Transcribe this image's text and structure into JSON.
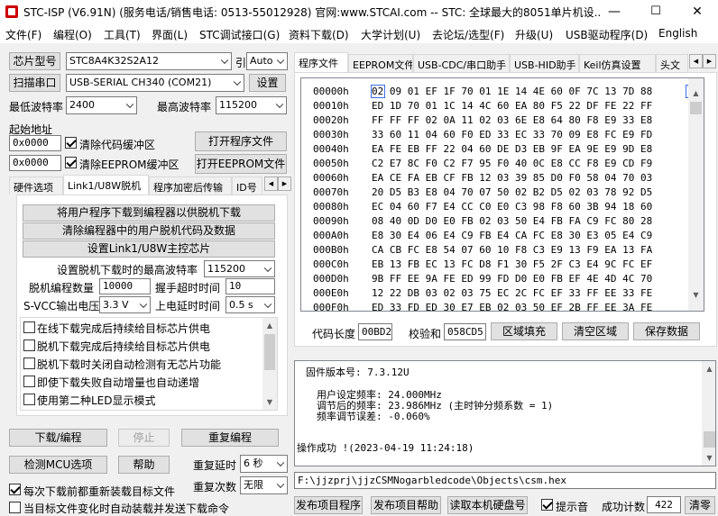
{
  "window": {
    "title": "STC-ISP (V6.91N) (服务电话/销售电话: 0513-55012928) 官网:www.STCAI.com  -- STC: 全球最大的8051单片机设...",
    "minimize": "—",
    "maximize": "☐",
    "close": "✕"
  },
  "menu": [
    "文件(F)",
    "编程(O)",
    "工具(T)",
    "界面(L)",
    "STC调试接口(G)",
    "资料下载(D)",
    "大学计划(U)",
    "去论坛/选型(F)",
    "升级(U)",
    "USB驱动程序(D)",
    "English"
  ],
  "left": {
    "chip_type_label": "芯片型号",
    "chip_type_value": "STC8A4K32S2A12",
    "pin_count_label": "引脚数",
    "pin_count_value": "Auto",
    "scan_port_label": "扫描串口",
    "port_value": "USB-SERIAL CH340 (COM21)",
    "settings_label": "设置",
    "min_baud_label": "最低波特率",
    "min_baud_value": "2400",
    "max_baud_label": "最高波特率",
    "max_baud_value": "115200",
    "start_addr_label": "起始地址",
    "addr1_value": "0x0000",
    "clear_code_label": "清除代码缓冲区",
    "open_program_label": "打开程序文件",
    "addr2_value": "0x0000",
    "clear_eeprom_label": "清除EEPROM缓冲区",
    "open_eeprom_label": "打开EEPROM文件",
    "tabs": [
      "硬件选项",
      "Link1/U8W脱机",
      "程序加密后传输",
      "ID号"
    ],
    "offline": {
      "btn1": "将用户程序下载到编程器以供脱机下载",
      "btn2": "清除编程器中的用户脱机代码及数据",
      "btn3": "设置Link1/U8W主控芯片",
      "max_baud_label": "设置脱机下载时的最高波特率",
      "max_baud_value": "115200",
      "count_label": "脱机编程数量",
      "count_value": "10000",
      "hand_delay_label": "握手超时时间",
      "hand_delay_value": "10",
      "vcc_label": "S-VCC输出电压",
      "vcc_value": "3.3 V",
      "power_delay_label": "上电延时时间",
      "power_delay_value": "0.5 s",
      "options": [
        "在线下载完成后持续给目标芯片供电",
        "脱机下载完成后持续给目标芯片供电",
        "脱机下载时关闭自动检测有无芯片功能",
        "即使下载失败自动增量也自动递增",
        "使用第二种LED显示模式"
      ]
    },
    "download_label": "下载/编程",
    "stop_label": "停止",
    "reprogram_label": "重复编程",
    "detect_mcu_label": "检测MCU选项",
    "help_label": "帮助",
    "repeat_delay_label": "重复延时",
    "repeat_delay_value": "6 秒",
    "reload_label": "每次下载前都重新装载目标文件",
    "repeat_count_label": "重复次数",
    "repeat_count_value": "无限",
    "auto_load_label": "当目标文件变化时自动装载并发送下载命令"
  },
  "right": {
    "tabs": [
      "程序文件",
      "EEPROM文件",
      "USB-CDC/串口助手",
      "USB-HID助手",
      "Keil仿真设置",
      "头文"
    ],
    "hex_rows": [
      {
        "addr": "00000h",
        "bytes": "02 09 01 EF 1F 70 01 1E 14 4E 60 0F 7C 13 7D 88"
      },
      {
        "addr": "00010h",
        "bytes": "ED 1D 70 01 1C 14 4C 60 EA 80 F5 22 DF FE 22 FF"
      },
      {
        "addr": "00020h",
        "bytes": "FF FF FF 02 0A 11 02 03 6E E8 64 80 F8 E9 33 E8"
      },
      {
        "addr": "00030h",
        "bytes": "33 60 11 04 60 F0 ED 33 EC 33 70 09 E8 FC E9 FD"
      },
      {
        "addr": "00040h",
        "bytes": "EA FE EB FF 22 04 60 DE D3 EB 9F EA 9E E9 9D E8"
      },
      {
        "addr": "00050h",
        "bytes": "C2 E7 8C F0 C2 F7 95 F0 40 0C E8 CC F8 E9 CD F9"
      },
      {
        "addr": "00060h",
        "bytes": "EA CE FA EB CF FB 12 03 39 85 D0 F0 58 04 70 03"
      },
      {
        "addr": "00070h",
        "bytes": "20 D5 B3 E8 04 70 07 50 02 B2 D5 02 03 78 92 D5"
      },
      {
        "addr": "00080h",
        "bytes": "EC 04 60 F7 E4 CC C0 E0 C3 98 F8 60 3B 94 18 60"
      },
      {
        "addr": "00090h",
        "bytes": "08 40 0D D0 E0 FB 02 03 50 E4 FB FA C9 FC 80 28"
      },
      {
        "addr": "000A0h",
        "bytes": "E8 30 E4 06 E4 C9 FB E4 CA FC E8 30 E3 05 E4 C9"
      },
      {
        "addr": "000B0h",
        "bytes": "CA CB FC E8 54 07 60 10 F8 C3 E9 13 F9 EA 13 FA"
      },
      {
        "addr": "000C0h",
        "bytes": "EB 13 FB EC 13 FC D8 F1 30 F5 2F C3 E4 9C FC EF"
      },
      {
        "addr": "000D0h",
        "bytes": "9B FF EE 9A FE ED 99 FD D0 E0 FB EF 4E 4D 4C 70"
      },
      {
        "addr": "000E0h",
        "bytes": "12 22 DB 03 02 03 75 EC 2C FC EF 33 FF EE 33 FE"
      },
      {
        "addr": "000F0h",
        "bytes": "ED 33 FD ED 30 E7 EB 02 03 50 EF 2B FF EE 3A FE"
      }
    ],
    "code_len_label": "代码长度",
    "code_len_value": "00BD2",
    "checksum_label": "校验和",
    "checksum_value": "058CD5",
    "fill_label": "区域填充",
    "clear_label": "清空区域",
    "save_label": "保存数据",
    "log": [
      "固件版本号: 7.3.12U",
      "",
      "用户设定频率: 24.000MHz",
      "调节后的频率: 23.986MHz (主时钟分频系数 = 1)",
      "频率调节误差: -0.060%",
      "",
      "",
      "操作成功 !(2023-04-19 11:24:18)"
    ],
    "file_path": "F:\\jjzprj\\jjzCSMNogarbledcode\\Objects\\csm.hex",
    "publish_program_label": "发布项目程序",
    "publish_help_label": "发布项目帮助",
    "read_disk_label": "读取本机硬盘号",
    "beep_label": "提示音",
    "success_count_label": "成功计数",
    "success_count_value": "422",
    "clear_count_label": "清零"
  },
  "colors": {
    "selection": "#3c6ee5",
    "disabled_text": "#a0a0a0"
  }
}
